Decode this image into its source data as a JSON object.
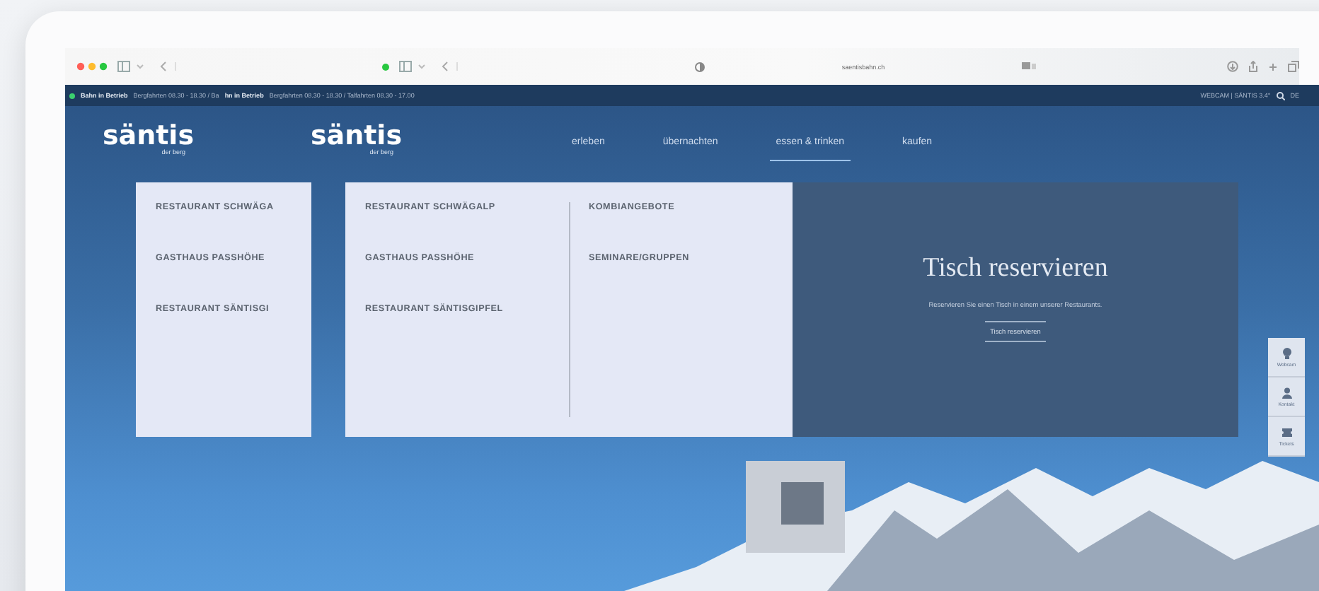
{
  "browser": {
    "url": "saentisbahn.ch"
  },
  "status_bar": {
    "back": {
      "status": "Bahn in Betrieb",
      "hours": "Bergfahrten 08.30 - 18.30 / Ba"
    },
    "front": {
      "status": "hn in Betrieb",
      "hours": "Bergfahrten 08.30 - 18.30 / Talfahrten 08.30 - 17.00"
    },
    "right": "WEBCAM | SÄNTIS 3.4°",
    "language": "DE"
  },
  "logos": [
    {
      "name": "säntis",
      "tagline": "der berg"
    },
    {
      "name": "säntis",
      "tagline": "der berg"
    }
  ],
  "nav": [
    {
      "label": "erleben",
      "selected": false
    },
    {
      "label": "übernachten",
      "selected": false
    },
    {
      "label": "essen & trinken",
      "selected": true
    },
    {
      "label": "kaufen",
      "selected": false
    }
  ],
  "back_menu": [
    "RESTAURANT SCHWÄGA",
    "GASTHAUS PASSHÖHE",
    "RESTAURANT SÄNTISGI"
  ],
  "menu_columns": [
    [
      "RESTAURANT SCHWÄGALP",
      "GASTHAUS PASSHÖHE",
      "RESTAURANT SÄNTISGIPFEL"
    ],
    [
      "KOMBIANGEBOTE",
      "SEMINARE/GRUPPEN"
    ]
  ],
  "promo": {
    "title": "Tisch reservieren",
    "text": "Reservieren Sie einen Tisch in einem unserer Restaurants.",
    "button": "Tisch reservieren"
  },
  "side_widgets": [
    {
      "kind": "webcam",
      "label": "Webcam"
    },
    {
      "kind": "contact",
      "label": "Kontakt"
    },
    {
      "kind": "ticket",
      "label": "Tickets"
    }
  ]
}
